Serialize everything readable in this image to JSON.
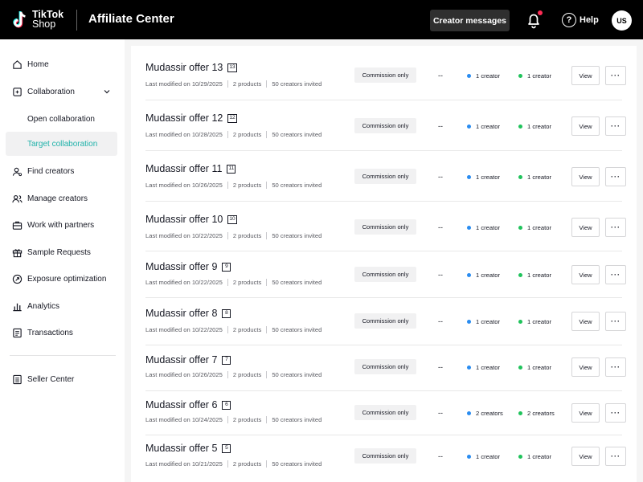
{
  "header": {
    "logo_line1": "TikTok",
    "logo_line2": "Shop",
    "title": "Affiliate Center",
    "creator_messages_label": "Creator messages",
    "help_label": "Help",
    "avatar_initials": "US"
  },
  "sidebar": {
    "items": [
      {
        "label": "Home",
        "icon": "home-icon"
      },
      {
        "label": "Collaboration",
        "icon": "collaboration-icon"
      },
      {
        "label": "Open collaboration"
      },
      {
        "label": "Target collaboration"
      },
      {
        "label": "Find creators",
        "icon": "find-creators-icon"
      },
      {
        "label": "Manage creators",
        "icon": "manage-creators-icon"
      },
      {
        "label": "Work with partners",
        "icon": "partners-icon"
      },
      {
        "label": "Sample Requests",
        "icon": "gift-icon"
      },
      {
        "label": "Exposure optimization",
        "icon": "exposure-icon"
      },
      {
        "label": "Analytics",
        "icon": "analytics-icon"
      },
      {
        "label": "Transactions",
        "icon": "transactions-icon"
      },
      {
        "label": "Seller Center",
        "icon": "seller-center-icon"
      }
    ],
    "active_item": "Target collaboration",
    "accent_color": "#20b2aa"
  },
  "offers": [
    {
      "title": "Mudassir offer 13",
      "num": "13",
      "modified": "Last modified on 10/29/2025",
      "products": "2 products",
      "invited": "50 creators invited",
      "commission": "Commission only",
      "dash": "--",
      "stat1": "1 creator",
      "stat2": "1 creator",
      "view": "View"
    },
    {
      "title": "Mudassir offer 12",
      "num": "12",
      "modified": "Last modified on 10/28/2025",
      "products": "2 products",
      "invited": "50 creators invited",
      "commission": "Commission only",
      "dash": "--",
      "stat1": "1 creator",
      "stat2": "1 creator",
      "view": "View"
    },
    {
      "title": "Mudassir offer 11",
      "num": "11",
      "modified": "Last modified on 10/26/2025",
      "products": "2 products",
      "invited": "50 creators invited",
      "commission": "Commission only",
      "dash": "--",
      "stat1": "1 creator",
      "stat2": "1 creator",
      "view": "View"
    },
    {
      "title": "Mudassir offer 10",
      "num": "10",
      "modified": "Last modified on 10/22/2025",
      "products": "2 products",
      "invited": "50 creators invited",
      "commission": "Commission only",
      "dash": "--",
      "stat1": "1 creator",
      "stat2": "1 creator",
      "view": "View"
    },
    {
      "title": "Mudassir offer 9",
      "num": "9",
      "modified": "Last modified on 10/22/2025",
      "products": "2 products",
      "invited": "50 creators invited",
      "commission": "Commission only",
      "dash": "--",
      "stat1": "1 creator",
      "stat2": "1 creator",
      "view": "View"
    },
    {
      "title": "Mudassir offer 8",
      "num": "8",
      "modified": "Last modified on 10/22/2025",
      "products": "2 products",
      "invited": "50 creators invited",
      "commission": "Commission only",
      "dash": "--",
      "stat1": "1 creator",
      "stat2": "1 creator",
      "view": "View"
    },
    {
      "title": "Mudassir offer 7",
      "num": "7",
      "modified": "Last modified on 10/26/2025",
      "products": "2 products",
      "invited": "50 creators invited",
      "commission": "Commission only",
      "dash": "--",
      "stat1": "1 creator",
      "stat2": "1 creator",
      "view": "View"
    },
    {
      "title": "Mudassir offer 6",
      "num": "6",
      "modified": "Last modified on 10/24/2025",
      "products": "2 products",
      "invited": "50 creators invited",
      "commission": "Commission only",
      "dash": "--",
      "stat1": "2 creators",
      "stat2": "2 creators",
      "view": "View"
    },
    {
      "title": "Mudassir offer 5",
      "num": "5",
      "modified": "Last modified on 10/21/2025",
      "products": "2 products",
      "invited": "50 creators invited",
      "commission": "Commission only",
      "dash": "--",
      "stat1": "1 creator",
      "stat2": "1 creator",
      "view": "View"
    }
  ],
  "colors": {
    "stat1_dot": "#2a8cf0",
    "stat2_dot": "#1fc35b",
    "notification_dot": "#fe2c55"
  }
}
